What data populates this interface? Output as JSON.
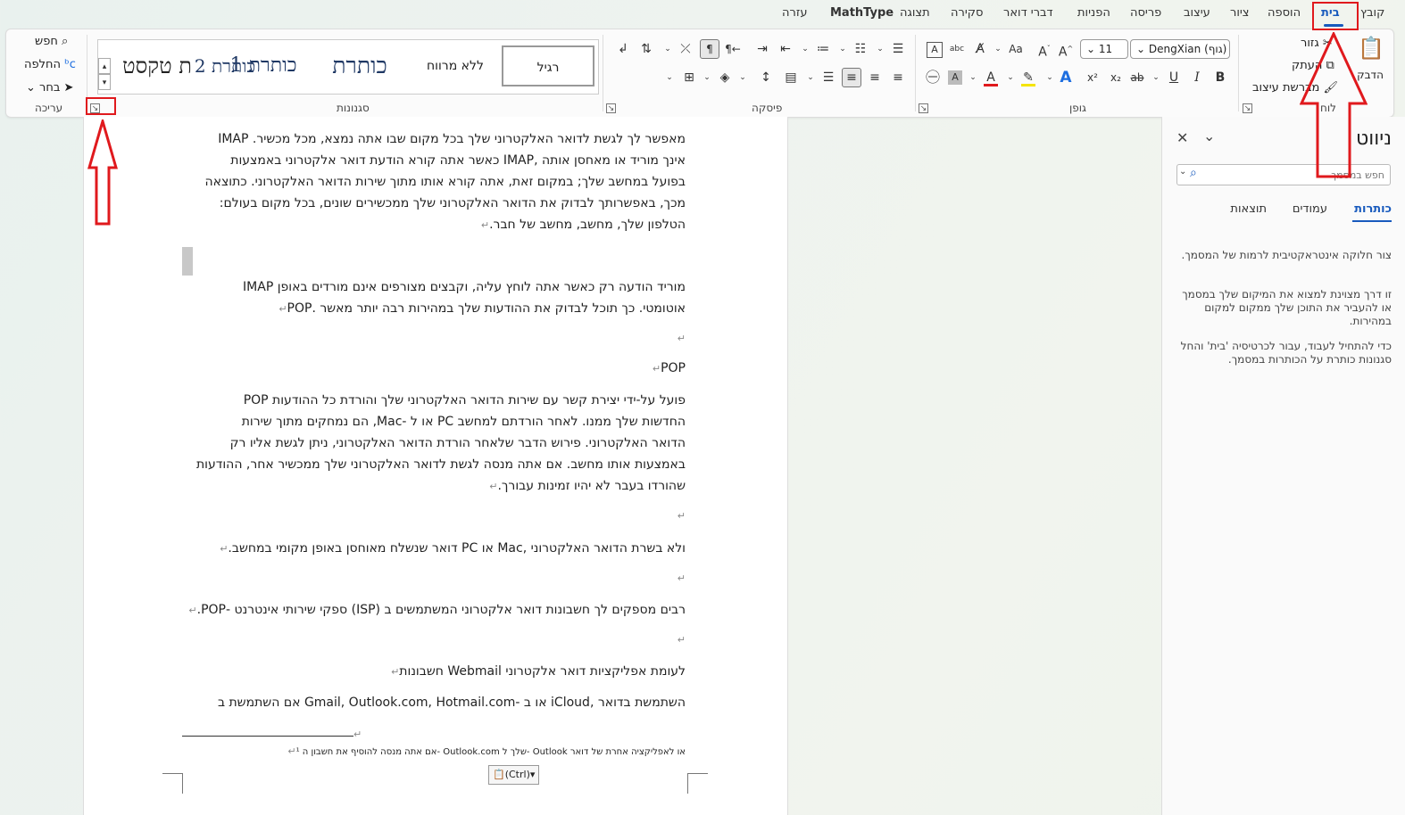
{
  "tabs": {
    "file": "קובץ",
    "home": "בית",
    "insert": "הוספה",
    "draw": "ציור",
    "design": "עיצוב",
    "layout": "פריסה",
    "references": "הפניות",
    "mailings": "דברי דואר",
    "review": "סקירה",
    "view": "תצוגה",
    "mathtype": "MathType",
    "help": "עזרה"
  },
  "clipboard": {
    "paste": "הדבק",
    "cut": "גזור",
    "copy": "העתק",
    "format_painter": "מברשת עיצוב",
    "label": "לוח"
  },
  "font": {
    "name": "DengXian (גוף)",
    "size": "11",
    "label": "גופן",
    "bold": "B",
    "italic": "I",
    "underline": "U",
    "strike": "ab",
    "subscript": "x₂",
    "superscript": "x²",
    "grow": "A^",
    "shrink": "Aˇ",
    "case": "Aa",
    "clear": "A",
    "phonetic": "abc",
    "textbox": "A",
    "highlight_color": "#f4e400",
    "font_color": "#e0191d",
    "text_effects": "A"
  },
  "paragraph": {
    "label": "פיסקה"
  },
  "styles": {
    "normal": "רגיל",
    "no_spacing": "ללא מרווח",
    "heading1": "כותרת 1",
    "heading2": "כותרת 2",
    "title": "כותרת",
    "subtitle": "ת טקסט",
    "label": "סגנונות"
  },
  "editing": {
    "find": "חפש",
    "replace": "החלפה",
    "select": "בחר",
    "label": "עריכה"
  },
  "document": {
    "p1": [
      "מאפשר לך לגשת לדואר האלקטרוני שלך בכל מקום שבו אתה נמצא, מכל מכשיר.  IMAP",
      "אינך מוריד או מאחסן אותה  ,IMAP  כאשר אתה קורא הודעת דואר אלקטרוני באמצעות",
      "בפועל במחשב שלך; במקום זאת, אתה קורא אותו מתוך שירות הדואר האלקטרוני. כתוצאה",
      "מכך, באפשרותך לבדוק את הדואר האלקטרוני שלך ממכשירים שונים, בכל מקום בעולם:",
      "הטלפון שלך, מחשב, מחשב של חבר."
    ],
    "p2": [
      "מוריד הודעה רק כאשר אתה לוחץ עליה, וקבצים מצורפים אינם מורדים באופן  IMAP",
      "אוטומטי. כך תוכל לבדוק את ההודעות שלך במהירות רבה יותר מאשר  .POP"
    ],
    "p3": "POP",
    "p4": [
      "פועל על-ידי יצירת קשר עם שירות הדואר האלקטרוני שלך והורדת כל ההודעות  POP",
      "החדשות שלך ממנו. לאחר הורדתם למחשב  PC או ל -Mac,  הם נמחקים מתוך שירות",
      "הדואר האלקטרוני. פירוש הדבר שלאחר הורדת הדואר האלקטרוני, ניתן לגשת אליו רק",
      "באמצעות אותו מחשב. אם אתה מנסה לגשת לדואר האלקטרוני שלך ממכשיר אחר, ההודעות",
      "שהורדו בעבר לא יהיו זמינות עבורך."
    ],
    "p5": "ולא בשרת הדואר האלקטרוני  ,Mac  או  PC  דואר שנשלח מאוחסן באופן מקומי במחשב.",
    "p6": "רבים מספקים לך חשבונות דואר אלקטרוני המשתמשים ב  (ISP)  ספקי שירותי אינטרנט -POP.",
    "p7": "לעומת אפליקציות דואר אלקטרוני  Webmail  חשבונות",
    "p8": "השתמשת בדואר  ,iCloud  או ב -Gmail, Outlook.com, Hotmail.com  אם השתמשת ב",
    "footnote": "או לאפליקציה אחרת של דואר  Outlook -שלך ל  Outlook.com  -אם אתה מנסה להוסיף את חשבון ה  ¹",
    "paste_options": "(Ctrl)"
  },
  "nav": {
    "title": "ניווט",
    "search_placeholder": "חפש במסמך",
    "tab_headings": "כותרות",
    "tab_pages": "עמודים",
    "tab_results": "תוצאות",
    "text1": "צור חלוקה אינטראקטיבית לרמות של המסמך.",
    "text2": "זו דרך מצוינת למצוא את המיקום שלך במסמך או להעביר את התוכן שלך ממקום למקום במהירות.",
    "text3": "כדי להתחיל לעבוד, עבור לכרטיסיה 'בית' והחל סגנונות כותרת על הכותרות במסמך."
  },
  "colors": {
    "accent": "#185abd",
    "annotation": "#e0191d"
  }
}
